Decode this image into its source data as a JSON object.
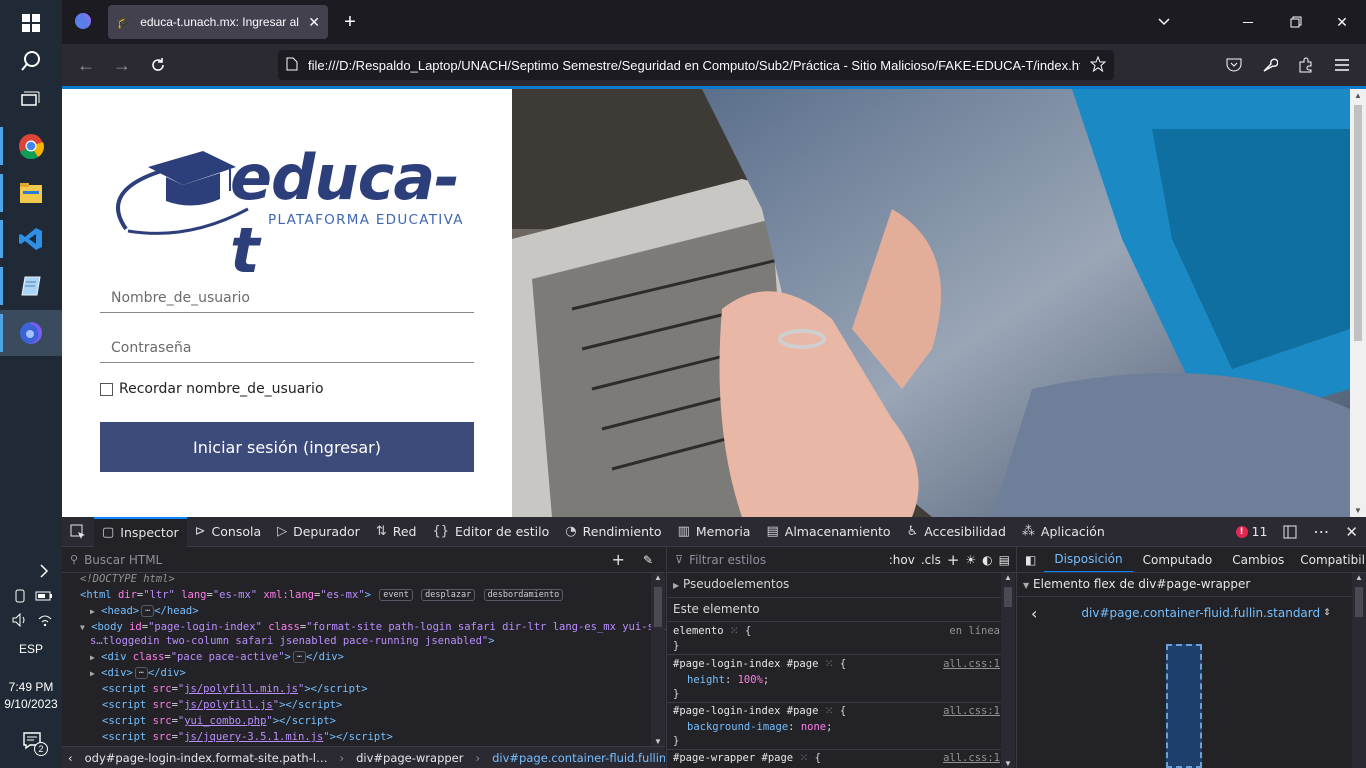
{
  "taskbar": {
    "language": "ESP",
    "time": "7:49 PM",
    "date": "9/10/2023",
    "notifications_count": "2",
    "icons": [
      "windows-start-icon",
      "search-icon",
      "task-view-icon",
      "chrome-icon",
      "file-explorer-icon",
      "vscode-icon",
      "notepad-icon",
      "firefox-icon"
    ]
  },
  "browser": {
    "tab_title": "educa-t.unach.mx: Ingresar al sitio",
    "url": "file:///D:/Respaldo_Laptop/UNACH/Septimo Semestre/Seguridad en Computo/Sub2/Práctica - Sitio Malicioso/FAKE-EDUCA-T/index.html"
  },
  "login": {
    "logo_text": "educa-t",
    "logo_subtitle": "PLATAFORMA EDUCATIVA",
    "username_placeholder": "Nombre_de_usuario",
    "password_placeholder": "Contraseña",
    "remember_label": "Recordar nombre_de_usuario",
    "remember_checked": false,
    "submit_label": "Iniciar sesión (ingresar)"
  },
  "devtools": {
    "tabs": [
      {
        "label": "Inspector",
        "icon": "inspector-icon",
        "active": true
      },
      {
        "label": "Consola",
        "icon": "console-icon"
      },
      {
        "label": "Depurador",
        "icon": "debugger-icon"
      },
      {
        "label": "Red",
        "icon": "network-icon"
      },
      {
        "label": "Editor de estilo",
        "icon": "style-editor-icon"
      },
      {
        "label": "Rendimiento",
        "icon": "performance-icon"
      },
      {
        "label": "Memoria",
        "icon": "memory-icon"
      },
      {
        "label": "Almacenamiento",
        "icon": "storage-icon"
      },
      {
        "label": "Accesibilidad",
        "icon": "accessibility-icon"
      },
      {
        "label": "Aplicación",
        "icon": "application-icon"
      }
    ],
    "error_count": "11",
    "html_search_placeholder": "Buscar HTML",
    "html_lines": {
      "doctype": "<!DOCTYPE html>",
      "html_tag": "html",
      "html_attrs": [
        [
          "dir",
          "ltr"
        ],
        [
          "lang",
          "es-mx"
        ],
        [
          "xml:lang",
          "es-mx"
        ]
      ],
      "badges": [
        "event",
        "desplazar",
        "desbordamiento"
      ],
      "head": "head",
      "body_id": "page-login-index",
      "body_class": "format-site path-login safari dir-ltr lang-es_mx yui-skin-s…tloggedin two-column safari jsenabled pace-running jsenabled",
      "div_pace_class": "pace pace-active",
      "script1": "js/polyfill.min.js",
      "script2": "js/polyfill.js",
      "script3": "yui_combo.php",
      "script4": "js/jquery-3.5.1.min.js"
    },
    "breadcrumb": [
      "ody#page-login-index.format-site.path-l…",
      "div#page-wrapper",
      "div#page.container-fluid.fullin.standard"
    ],
    "styles": {
      "filter_placeholder": "Filtrar estilos",
      "hov": ":hov",
      "cls": ".cls",
      "pseudo": "Pseudoelementos",
      "this_element": "Este elemento",
      "inline_selector": "elemento",
      "inline_src": "en línea",
      "rules": [
        {
          "selector": "#page-login-index #page",
          "prop": "height",
          "value": "100%",
          "src": "all.css:1"
        },
        {
          "selector": "#page-login-index #page",
          "prop": "background-image",
          "value": "none",
          "src": "all.css:1"
        },
        {
          "selector": "#page-wrapper #page",
          "prop": "",
          "value": "",
          "src": "all.css:1"
        }
      ]
    },
    "layout": {
      "tabs": [
        "Disposición",
        "Computado",
        "Cambios",
        "Compatibili"
      ],
      "flex_header": "Elemento flex de div#page-wrapper",
      "flex_item": "div#page.container-fluid.fullin.standard"
    }
  }
}
